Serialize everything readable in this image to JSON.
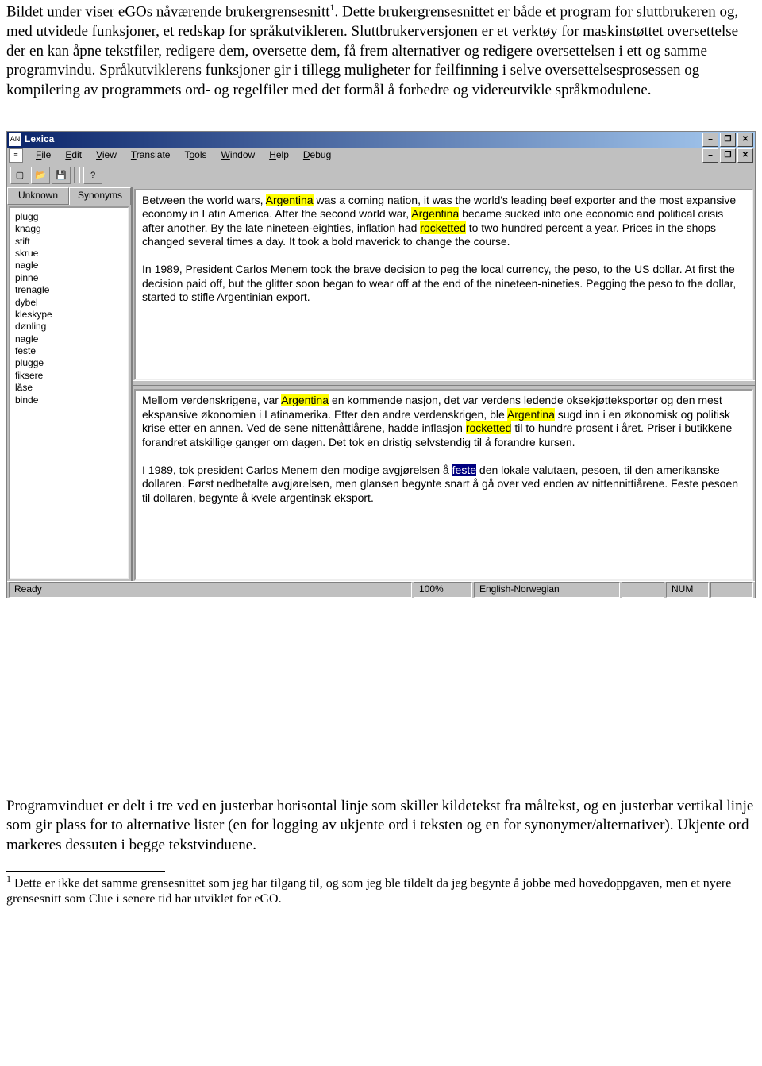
{
  "para1": "Bildet under viser eGOs nåværende brukergrensesnitt",
  "sup1": "1",
  "para1b": ". Dette brukergrensesnittet er både et program for sluttbrukeren og, med utvidede funksjoner, et redskap for språkutvikleren. Sluttbrukerversjonen er et verktøy for maskinstøttet oversettelse der en kan åpne tekstfiler, redigere dem, oversette dem, få frem alternativer og redigere oversettelsen i ett og samme programvindu. Språkutviklerens funksjoner gir i tillegg muligheter for feilfinning i selve oversettelsesprosessen og kompilering av programmets ord- og regelfiler med det formål å forbedre og videreutvikle språkmodulene.",
  "app": {
    "title": "Lexica",
    "icon": "AN",
    "menus": [
      "File",
      "Edit",
      "View",
      "Translate",
      "Tools",
      "Window",
      "Help",
      "Debug"
    ],
    "tabs": {
      "unknown": "Unknown",
      "synonyms": "Synonyms"
    },
    "wordlist": [
      "plugg",
      "knagg",
      "stift",
      "skrue",
      "nagle",
      "pinne",
      "trenagle",
      "dybel",
      "kleskype",
      "dønling",
      "nagle",
      "feste",
      "plugge",
      "fiksere",
      "låse",
      "binde"
    ],
    "source_p1a": "Between the world wars, ",
    "source_p1_arg": "Argentina",
    "source_p1b": " was a coming nation, it was the world's leading beef exporter and the most expansive economy in Latin America. After the second world war, ",
    "source_p1c": " became sucked into one economic and political crisis after another. By the late nineteen-eighties, inflation had ",
    "source_p1_rock": "rocketted",
    "source_p1d": " to two hundred percent a year. Prices in the shops changed several times a day. It took a bold maverick to change the course.",
    "source_p2": "In 1989, President Carlos Menem took the brave decision to peg the local currency, the peso, to the US dollar. At first the decision paid off, but the glitter soon began to wear off at the end of the nineteen-nineties. Pegging the peso to the dollar, started to stifle Argentinian export.",
    "target_p1a": "Mellom verdenskrigene, var ",
    "target_p1b": " en kommende nasjon, det var verdens ledende oksekjøtteksportør og den mest ekspansive økonomien i Latinamerika. Etter den andre verdenskrigen, ble ",
    "target_p1c": " sugd inn i en økonomisk og politisk krise etter en annen. Ved de sene nittenåttiårene, hadde inflasjon ",
    "target_p1d": " til to hundre prosent i året. Priser i butikkene forandret atskillige ganger om dagen. Det tok en dristig selvstendig til å forandre kursen.",
    "target_p2a": "I 1989, tok president Carlos Menem den modige avgjørelsen å ",
    "target_p2_sel": "feste",
    "target_p2b": " den lokale valutaen, pesoen, til den amerikanske dollaren. Først nedbetalte avgjørelsen, men glansen begynte snart å gå over ved enden av nittennittiårene. Feste pesoen til dollaren, begynte å kvele argentinsk eksport.",
    "status": {
      "ready": "Ready",
      "zoom": "100%",
      "lang": "English-Norwegian",
      "num": "NUM"
    }
  },
  "para2": "Programvinduet er delt i tre ved en justerbar horisontal linje som skiller kildetekst fra måltekst, og en justerbar vertikal linje som gir plass for to alternative lister (en for logging av ukjente ord i teksten og en for synonymer/alternativer). Ukjente ord markeres dessuten i begge tekstvinduene.",
  "footnote_marker": "1",
  "footnote": " Dette er ikke det samme grensesnittet som jeg har tilgang til, og som jeg ble tildelt da jeg begynte å jobbe med hovedoppgaven, men et nyere grensesnitt som Clue i senere tid har utviklet for eGO."
}
